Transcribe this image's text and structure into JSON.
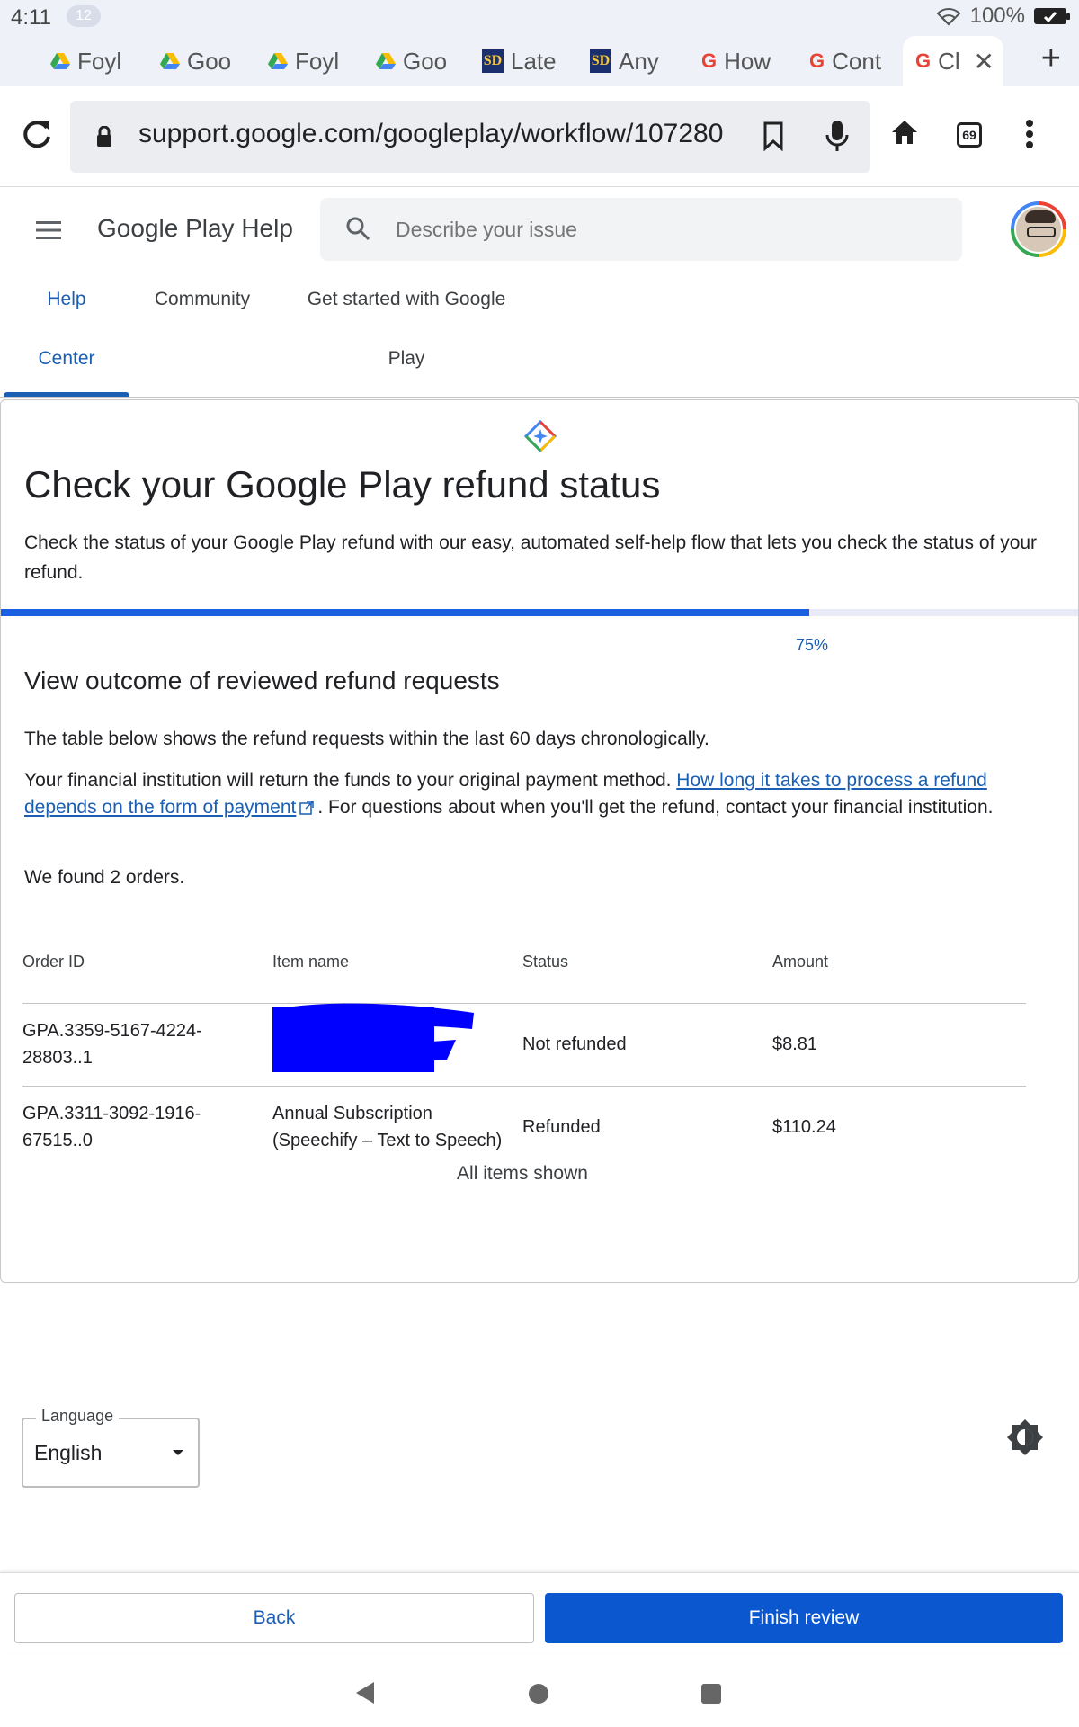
{
  "status_bar": {
    "time": "4:11",
    "notification_count": "12",
    "battery": "100%"
  },
  "tabs": [
    {
      "label": "Foyl",
      "icon": "google-drive-icon"
    },
    {
      "label": "Goo",
      "icon": "google-drive-icon"
    },
    {
      "label": "Foyl",
      "icon": "google-drive-icon"
    },
    {
      "label": "Goo",
      "icon": "google-drive-icon"
    },
    {
      "label": "Late",
      "icon": "sd-icon"
    },
    {
      "label": "Any",
      "icon": "sd-icon"
    },
    {
      "label": "How",
      "icon": "google-g-icon"
    },
    {
      "label": "Cont",
      "icon": "google-g-icon"
    },
    {
      "label": "Cl",
      "icon": "google-g-icon",
      "active": true
    }
  ],
  "browser": {
    "url": "support.google.com/googleplay/workflow/107280",
    "tab_count": "69"
  },
  "help_header": {
    "brand": "Google Play Help",
    "search_placeholder": "Describe your issue"
  },
  "nav": {
    "help_center_line1": "Help",
    "help_center_line2": "Center",
    "community": "Community",
    "get_started_line1": "Get started with Google",
    "get_started_line2": "Play"
  },
  "page": {
    "title": "Check your Google Play refund status",
    "intro": "Check the status of your Google Play refund with our easy, automated self-help flow that lets you check the status of your refund.",
    "progress_percent": 75,
    "progress_label": "75%",
    "section_title": "View outcome of reviewed refund requests",
    "para1": "The table below shows the refund requests within the last 60 days chronologically.",
    "para2_before": "Your financial institution will return the funds to your original payment method. ",
    "para2_link": "How long it takes to process a refund depends on the form of payment",
    "para2_after": ". For questions about when you'll get the refund, contact your financial institution.",
    "found": "We found 2 orders.",
    "all_items": "All items shown"
  },
  "table": {
    "headers": [
      "Order ID",
      "Item name",
      "Status",
      "Amount"
    ],
    "rows": [
      {
        "order_id": "GPA.3359-5167-4224-28803..1",
        "item": "",
        "status": "Not refunded",
        "amount": "$8.81"
      },
      {
        "order_id": "GPA.3311-3092-1916-67515..0",
        "item": "Annual Subscription (Speechify – Text to Speech)",
        "status": "Refunded",
        "amount": "$110.24"
      }
    ]
  },
  "footer": {
    "language_label": "Language",
    "language_value": "English"
  },
  "actions": {
    "back": "Back",
    "finish": "Finish review"
  },
  "colors": {
    "accent": "#1a5fb4",
    "primary_button": "#0b57d0",
    "progress": "#1a5fe0",
    "redaction": "#0000ff"
  }
}
